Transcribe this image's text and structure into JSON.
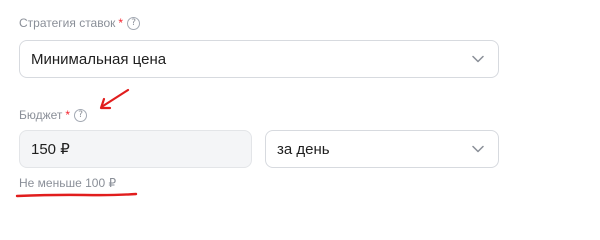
{
  "strategy": {
    "label": "Стратегия ставок",
    "required_mark": "*",
    "help_icon": "question-circle-icon",
    "selected": "Минимальная цена"
  },
  "budget": {
    "label": "Бюджет",
    "required_mark": "*",
    "help_icon": "question-circle-icon",
    "value": "150 ₽",
    "period_selected": "за день",
    "hint": "Не меньше 100 ₽"
  },
  "colors": {
    "required": "#f5222d",
    "annotation": "#e11d1d",
    "muted_text": "#8a8f98"
  }
}
